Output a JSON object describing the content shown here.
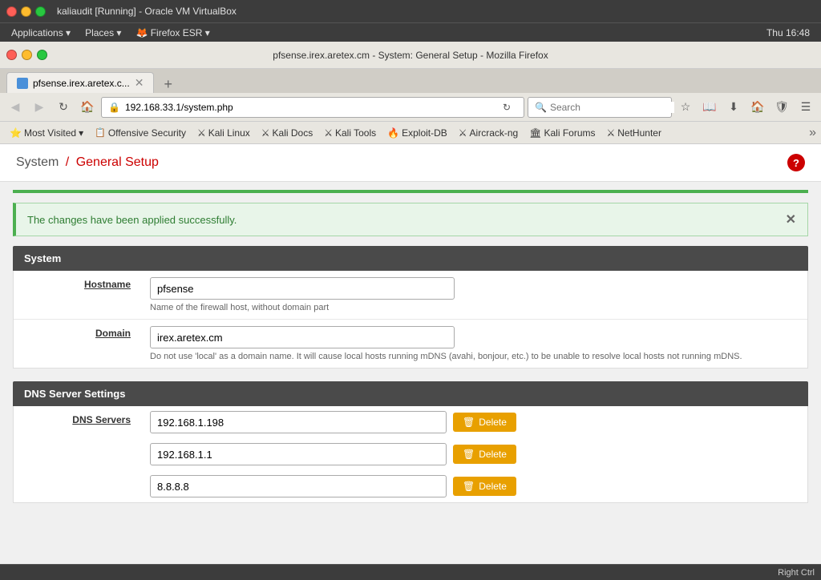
{
  "window": {
    "title": "kaliaudit [Running] - Oracle VM VirtualBox",
    "os_title": "kaliaudit [Running] - Oracle VM VirtualBox"
  },
  "os_menubar": {
    "items": [
      "Applications",
      "Places",
      "Firefox ESR"
    ],
    "clock": "Thu 16:48"
  },
  "browser": {
    "title": "pfsense.irex.aretex.cm - System: General Setup - Mozilla Firefox",
    "tab_label": "pfsense.irex.aretex.c...",
    "address": "192.168.33.1/system.php",
    "search_placeholder": "Search"
  },
  "bookmarks": [
    {
      "label": "Most Visited",
      "has_arrow": true
    },
    {
      "label": "Offensive Security"
    },
    {
      "label": "Kali Linux"
    },
    {
      "label": "Kali Docs"
    },
    {
      "label": "Kali Tools"
    },
    {
      "label": "Exploit-DB"
    },
    {
      "label": "Aircrack-ng"
    },
    {
      "label": "Kali Forums"
    },
    {
      "label": "NetHunter"
    }
  ],
  "page": {
    "breadcrumb_root": "System",
    "breadcrumb_separator": "/",
    "breadcrumb_current": "General Setup",
    "success_message": "The changes have been applied successfully.",
    "section_system": "System",
    "section_dns": "DNS Server Settings",
    "hostname_label": "Hostname",
    "hostname_value": "pfsense",
    "hostname_help": "Name of the firewall host, without domain part",
    "domain_label": "Domain",
    "domain_value": "irex.aretex.cm",
    "domain_help": "Do not use 'local' as a domain name. It will cause local hosts running mDNS (avahi, bonjour, etc.) to be unable to resolve local hosts not running mDNS.",
    "dns_label": "DNS Servers",
    "dns_servers": [
      "192.168.1.198",
      "192.168.1.1",
      "8.8.8.8"
    ],
    "delete_label": "Delete"
  }
}
